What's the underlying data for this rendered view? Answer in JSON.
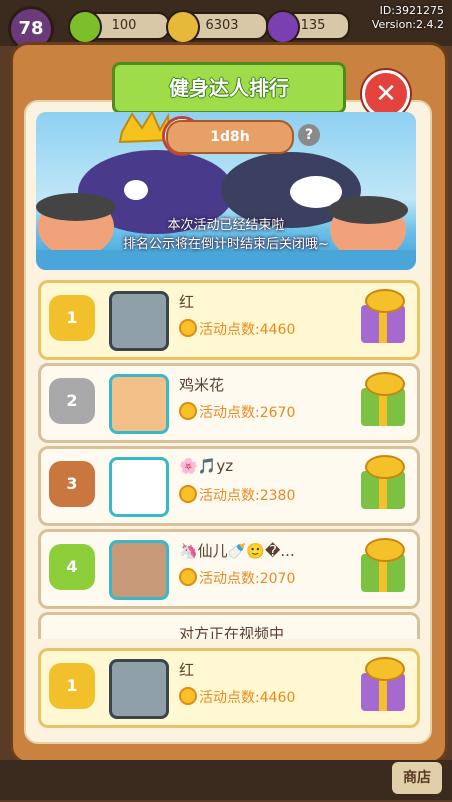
{
  "hud": {
    "level": "78",
    "resources": [
      {
        "name": "energy",
        "value": "100",
        "color": "#7cbf2a"
      },
      {
        "name": "coin",
        "value": "6303",
        "color": "#e7b93a"
      },
      {
        "name": "gem",
        "value": "135",
        "color": "#7a3fb0"
      }
    ],
    "id_text": "ID:3921275",
    "version_text": "Version:2.4.2"
  },
  "modal": {
    "title": "健身达人排行",
    "timer": "1d8h",
    "help": "?",
    "notice_line1": "本次活动已经结束啦",
    "notice_line2": "排名公示将在倒计时结束后关闭哦~"
  },
  "rows": [
    {
      "rank": "1",
      "name": "红",
      "points": "活动点数:4460",
      "rank_color": "#f2c02a",
      "gift_color": "#a46ad0"
    },
    {
      "rank": "2",
      "name": "鸡米花",
      "points": "活动点数:2670",
      "rank_color": "#a9a9a9",
      "gift_color": "#7cc142"
    },
    {
      "rank": "3",
      "name": "🌸🎵yz",
      "points": "活动点数:2380",
      "rank_color": "#c9773e",
      "gift_color": "#7cc142"
    },
    {
      "rank": "4",
      "name": "🦄仙儿🍼🙂�...",
      "points": "活动点数:2070",
      "rank_color": "#8ccf3a",
      "gift_color": "#7cc142"
    },
    {
      "rank": "",
      "name": "对方正在视频中",
      "points": "",
      "rank_color": "#8ccf3a",
      "gift_color": "#7cc142"
    }
  ],
  "my_row": {
    "rank": "1",
    "name": "红",
    "points": "活动点数:4460",
    "rank_color": "#f2c02a",
    "gift_color": "#a46ad0"
  },
  "bottom": {
    "shop_label": "商店"
  }
}
